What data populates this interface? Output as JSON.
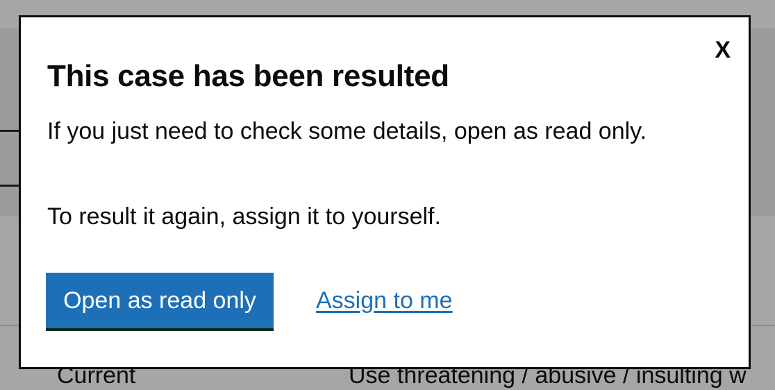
{
  "background": {
    "row_status": "Current",
    "row_offence": "Use threatening / abusive / insulting w"
  },
  "modal": {
    "close_label": "X",
    "title": "This case has been resulted",
    "paragraph_1": "If you just need to check some details, open as read only.",
    "paragraph_2": "To result it again, assign it to yourself.",
    "primary_button_label": "Open as read only",
    "secondary_link_label": "Assign to me"
  },
  "colors": {
    "overlay": "#a6a6a6",
    "modal_background": "#ffffff",
    "primary_button": "#1d70b8",
    "primary_button_shadow": "#002d18",
    "link": "#1d70b8",
    "text": "#0b0c0c"
  }
}
